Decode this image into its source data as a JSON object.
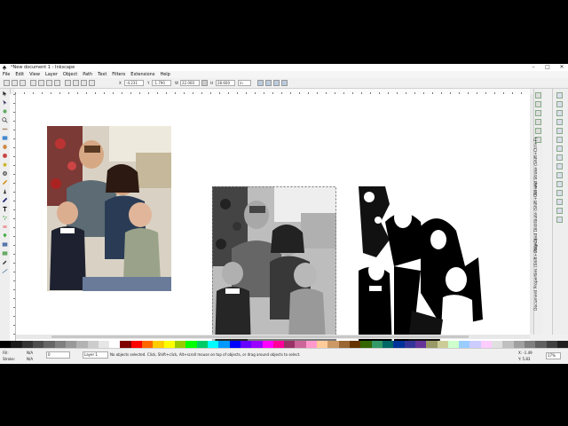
{
  "window": {
    "title": "*New document 1 - Inkscape",
    "controls": {
      "minimize": "–",
      "maximize": "□",
      "close": "✕"
    }
  },
  "menu": [
    "File",
    "Edit",
    "View",
    "Layer",
    "Object",
    "Path",
    "Text",
    "Filters",
    "Extensions",
    "Help"
  ],
  "tool_controls": {
    "x": "-4.231",
    "y": "-1.790",
    "w": "22.000",
    "h": "28.600",
    "unit": "in"
  },
  "docked_dialogs": [
    "Fill and Stroke (Shift+Ctrl+F)",
    "Align and Distribute (Shift+Ctrl+A)",
    "Document Properties (Shift+Ctrl+D)",
    "Trace Bitmap (Shift+Alt+B)"
  ],
  "status": {
    "fill_label": "Fill:",
    "fill_value": "N/A",
    "stroke_label": "Stroke:",
    "stroke_value": "N/A",
    "opacity": "0",
    "layer": "Layer 1",
    "message": "No objects selected. Click, Shift+click, Alt+scroll mouse on top of objects, or drag around objects to select.",
    "coord_x": "X: -1.49",
    "coord_y": "Y: 5.83",
    "zoom": "17%"
  },
  "images": [
    {
      "name": "original-color-photo",
      "style": "color"
    },
    {
      "name": "grayscale-trace-photo",
      "style": "grayscale"
    },
    {
      "name": "black-white-trace-photo",
      "style": "threshold"
    }
  ],
  "palette_colors": [
    "#000000",
    "#1a1a1a",
    "#333333",
    "#4d4d4d",
    "#666666",
    "#808080",
    "#999999",
    "#b3b3b3",
    "#cccccc",
    "#e6e6e6",
    "#ffffff",
    "#800000",
    "#ff0000",
    "#ff6600",
    "#ffcc00",
    "#ffff00",
    "#99cc00",
    "#00ff00",
    "#00cc66",
    "#00ffff",
    "#0099ff",
    "#0000ff",
    "#6600ff",
    "#9900ff",
    "#ff00ff",
    "#ff0099",
    "#993366",
    "#cc6699",
    "#ff99cc",
    "#ffcc99",
    "#cc9966",
    "#996633",
    "#663300",
    "#336600",
    "#339966",
    "#006666",
    "#003399",
    "#333399",
    "#663399",
    "#999966",
    "#cccc99",
    "#ccffcc",
    "#99ccff",
    "#ccccff",
    "#ffccff",
    "#e0e0e0",
    "#c0c0c0",
    "#a0a0a0",
    "#808080",
    "#606060",
    "#404040",
    "#202020"
  ]
}
